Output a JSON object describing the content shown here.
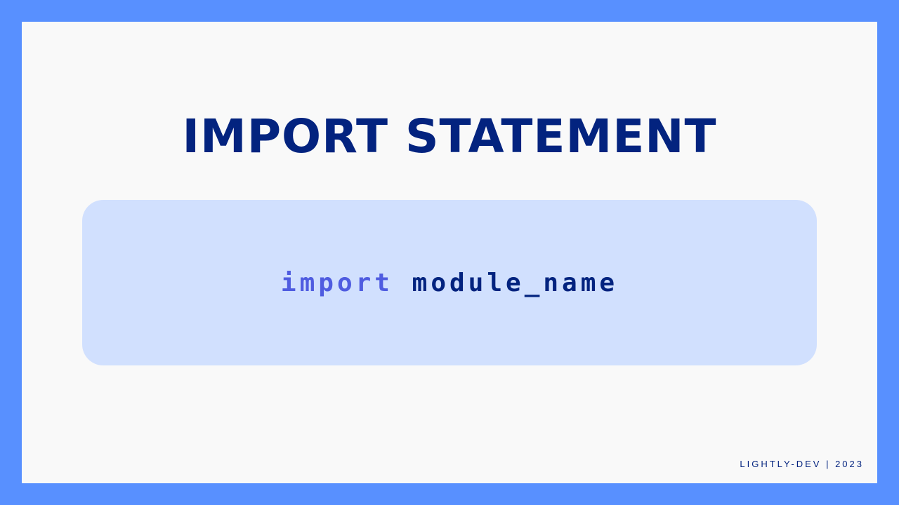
{
  "slide": {
    "title": "IMPORT STATEMENT",
    "code": {
      "keyword": "import",
      "identifier": "module_name"
    },
    "footer": "LIGHTLY-DEV | 2023"
  },
  "colors": {
    "frame": "#5890ff",
    "background": "#f9f9f9",
    "title": "#03237f",
    "code_box": "#d1e0fe",
    "keyword": "#4f5ce0",
    "identifier": "#03237f"
  }
}
